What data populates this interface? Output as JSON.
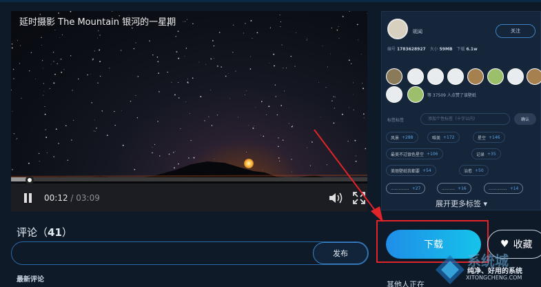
{
  "video": {
    "title": "延时摄影 The Mountain 银河的一星期",
    "current_time": "00:12",
    "duration": "/ 03:09",
    "progress": 0.06
  },
  "comments": {
    "heading": "评论",
    "count": "41",
    "submit_label": "发布",
    "latest_label": "最新评论"
  },
  "author": {
    "name": "昵闻",
    "follow_label": "关注",
    "meta": [
      {
        "label": "编号",
        "value": "1783628927"
      },
      {
        "label": "大小",
        "value": "59MB"
      },
      {
        "label": "下载",
        "value": "6.1w"
      }
    ],
    "likes_text": "等 37509 人点赞了该壁纸"
  },
  "tags": {
    "label": "标签标签",
    "input_placeholder": "添加个性标签（十字以内）",
    "confirm_label": "确认",
    "items": [
      {
        "name": "风景",
        "count": "+288"
      },
      {
        "name": "唯美",
        "count": "+172"
      },
      {
        "name": "星空",
        "count": "+146"
      },
      {
        "name": "最美不过银色星空",
        "count": "+106"
      },
      {
        "name": "记录",
        "count": "+35"
      },
      {
        "name": "美丽壁纸我都要",
        "count": "+54"
      },
      {
        "name": "治愈",
        "count": "+50"
      },
      {
        "name": "..............",
        "count": "+27"
      },
      {
        "name": "..........",
        "count": "+16"
      },
      {
        "name": "..............",
        "count": "+14"
      }
    ],
    "more_label": "展开更多标签"
  },
  "actions": {
    "download_label": "下载",
    "collect_label": "收藏",
    "others_label": "其他人正在"
  },
  "watermark": {
    "title": "系统城",
    "subtitle": "纯净、好用的系统",
    "url": "XITONGCHENG.COM"
  },
  "colors": {
    "background": "#0f1a28",
    "download_gradient_start": "#1f8ee8",
    "download_gradient_end": "#15c3ea",
    "highlight_red": "#e0242a"
  }
}
